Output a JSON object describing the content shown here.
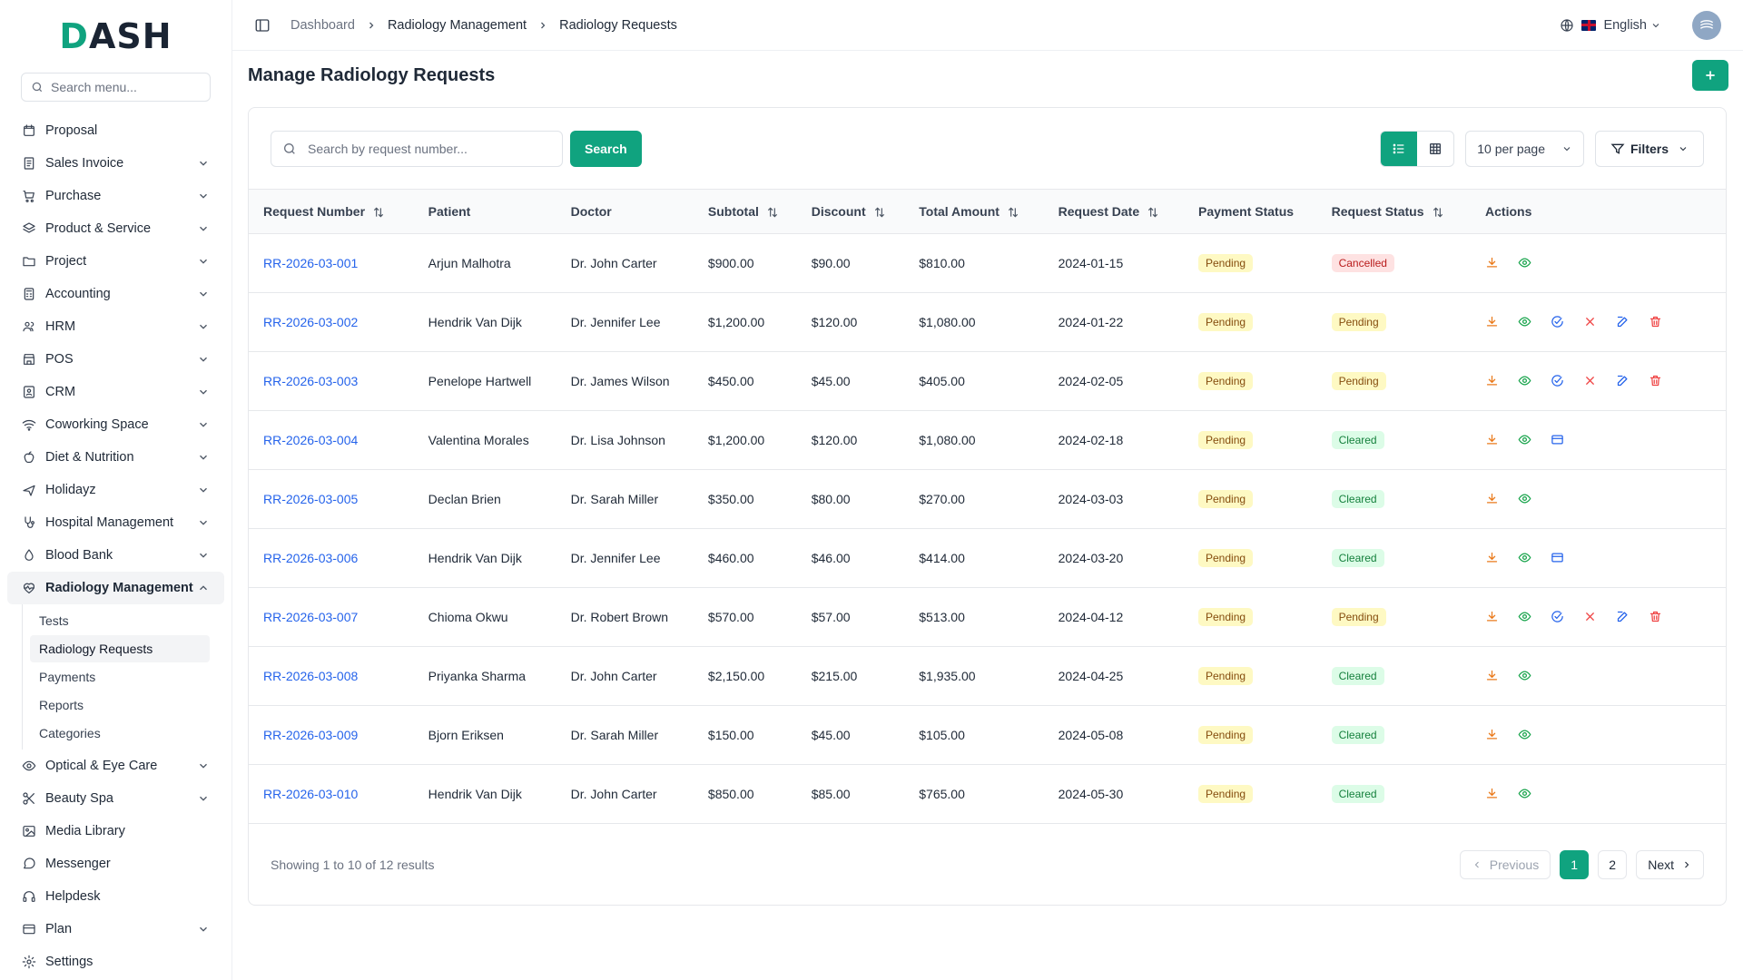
{
  "app": {
    "logo": "DASH"
  },
  "sidebar": {
    "search_placeholder": "Search menu...",
    "items": [
      {
        "label": "Proposal",
        "icon": "proposal-icon",
        "has_children": false
      },
      {
        "label": "Sales Invoice",
        "icon": "invoice-icon",
        "has_children": true
      },
      {
        "label": "Purchase",
        "icon": "cart-icon",
        "has_children": true
      },
      {
        "label": "Product & Service",
        "icon": "layers-icon",
        "has_children": true
      },
      {
        "label": "Project",
        "icon": "folder-icon",
        "has_children": true
      },
      {
        "label": "Accounting",
        "icon": "calculator-icon",
        "has_children": true
      },
      {
        "label": "HRM",
        "icon": "users-icon",
        "has_children": true
      },
      {
        "label": "POS",
        "icon": "store-icon",
        "has_children": true
      },
      {
        "label": "CRM",
        "icon": "contact-icon",
        "has_children": true
      },
      {
        "label": "Coworking Space",
        "icon": "wifi-icon",
        "has_children": true
      },
      {
        "label": "Diet & Nutrition",
        "icon": "apple-icon",
        "has_children": true
      },
      {
        "label": "Holidayz",
        "icon": "plane-icon",
        "has_children": true
      },
      {
        "label": "Hospital Management",
        "icon": "stethoscope-icon",
        "has_children": true
      },
      {
        "label": "Blood Bank",
        "icon": "droplet-icon",
        "has_children": true
      },
      {
        "label": "Radiology Management",
        "icon": "heart-pulse-icon",
        "has_children": true,
        "expanded": true
      },
      {
        "label": "Optical & Eye Care",
        "icon": "eye-icon",
        "has_children": true
      },
      {
        "label": "Beauty Spa",
        "icon": "scissors-icon",
        "has_children": true
      },
      {
        "label": "Media Library",
        "icon": "image-icon",
        "has_children": false
      },
      {
        "label": "Messenger",
        "icon": "message-icon",
        "has_children": false
      },
      {
        "label": "Helpdesk",
        "icon": "headset-icon",
        "has_children": false
      },
      {
        "label": "Plan",
        "icon": "credit-card-icon",
        "has_children": true
      },
      {
        "label": "Settings",
        "icon": "gear-icon",
        "has_children": false
      }
    ],
    "submenu": [
      "Tests",
      "Radiology Requests",
      "Payments",
      "Reports",
      "Categories"
    ],
    "submenu_active": "Radiology Requests"
  },
  "topbar": {
    "breadcrumb": [
      "Dashboard",
      "Radiology Management",
      "Radiology Requests"
    ],
    "language": "English"
  },
  "page": {
    "title": "Manage Radiology Requests",
    "search_placeholder": "Search by request number...",
    "search_button": "Search",
    "per_page": "10 per page",
    "filters": "Filters"
  },
  "table": {
    "headers": [
      "Request Number",
      "Patient",
      "Doctor",
      "Subtotal",
      "Discount",
      "Total Amount",
      "Request Date",
      "Payment Status",
      "Request Status",
      "Actions"
    ],
    "sortable": [
      true,
      false,
      false,
      true,
      true,
      true,
      true,
      false,
      true,
      false
    ],
    "rows": [
      {
        "num": "RR-2026-03-001",
        "patient": "Arjun Malhotra",
        "doctor": "Dr. John Carter",
        "subtotal": "$900.00",
        "discount": "$90.00",
        "total": "$810.00",
        "date": "2024-01-15",
        "payment": "Pending",
        "status": "Cancelled",
        "actions": [
          "download",
          "view"
        ]
      },
      {
        "num": "RR-2026-03-002",
        "patient": "Hendrik Van Dijk",
        "doctor": "Dr. Jennifer Lee",
        "subtotal": "$1,200.00",
        "discount": "$120.00",
        "total": "$1,080.00",
        "date": "2024-01-22",
        "payment": "Pending",
        "status": "Pending",
        "actions": [
          "download",
          "view",
          "approve",
          "reject",
          "edit",
          "delete"
        ]
      },
      {
        "num": "RR-2026-03-003",
        "patient": "Penelope Hartwell",
        "doctor": "Dr. James Wilson",
        "subtotal": "$450.00",
        "discount": "$45.00",
        "total": "$405.00",
        "date": "2024-02-05",
        "payment": "Pending",
        "status": "Pending",
        "actions": [
          "download",
          "view",
          "approve",
          "reject",
          "edit",
          "delete"
        ]
      },
      {
        "num": "RR-2026-03-004",
        "patient": "Valentina Morales",
        "doctor": "Dr. Lisa Johnson",
        "subtotal": "$1,200.00",
        "discount": "$120.00",
        "total": "$1,080.00",
        "date": "2024-02-18",
        "payment": "Pending",
        "status": "Cleared",
        "actions": [
          "download",
          "view",
          "payment"
        ]
      },
      {
        "num": "RR-2026-03-005",
        "patient": "Declan Brien",
        "doctor": "Dr. Sarah Miller",
        "subtotal": "$350.00",
        "discount": "$80.00",
        "total": "$270.00",
        "date": "2024-03-03",
        "payment": "Pending",
        "status": "Cleared",
        "actions": [
          "download",
          "view"
        ]
      },
      {
        "num": "RR-2026-03-006",
        "patient": "Hendrik Van Dijk",
        "doctor": "Dr. Jennifer Lee",
        "subtotal": "$460.00",
        "discount": "$46.00",
        "total": "$414.00",
        "date": "2024-03-20",
        "payment": "Pending",
        "status": "Cleared",
        "actions": [
          "download",
          "view",
          "payment"
        ]
      },
      {
        "num": "RR-2026-03-007",
        "patient": "Chioma Okwu",
        "doctor": "Dr. Robert Brown",
        "subtotal": "$570.00",
        "discount": "$57.00",
        "total": "$513.00",
        "date": "2024-04-12",
        "payment": "Pending",
        "status": "Pending",
        "actions": [
          "download",
          "view",
          "approve",
          "reject",
          "edit",
          "delete"
        ]
      },
      {
        "num": "RR-2026-03-008",
        "patient": "Priyanka Sharma",
        "doctor": "Dr. John Carter",
        "subtotal": "$2,150.00",
        "discount": "$215.00",
        "total": "$1,935.00",
        "date": "2024-04-25",
        "payment": "Pending",
        "status": "Cleared",
        "actions": [
          "download",
          "view"
        ]
      },
      {
        "num": "RR-2026-03-009",
        "patient": "Bjorn Eriksen",
        "doctor": "Dr. Sarah Miller",
        "subtotal": "$150.00",
        "discount": "$45.00",
        "total": "$105.00",
        "date": "2024-05-08",
        "payment": "Pending",
        "status": "Cleared",
        "actions": [
          "download",
          "view"
        ]
      },
      {
        "num": "RR-2026-03-010",
        "patient": "Hendrik Van Dijk",
        "doctor": "Dr. John Carter",
        "subtotal": "$850.00",
        "discount": "$85.00",
        "total": "$765.00",
        "date": "2024-05-30",
        "payment": "Pending",
        "status": "Cleared",
        "actions": [
          "download",
          "view"
        ]
      }
    ]
  },
  "pagination": {
    "showing": "Showing 1 to 10 of 12 results",
    "previous": "Previous",
    "pages": [
      "1",
      "2"
    ],
    "current": "1",
    "next": "Next"
  },
  "colors": {
    "accent": "#10a37f",
    "link": "#2563eb"
  }
}
